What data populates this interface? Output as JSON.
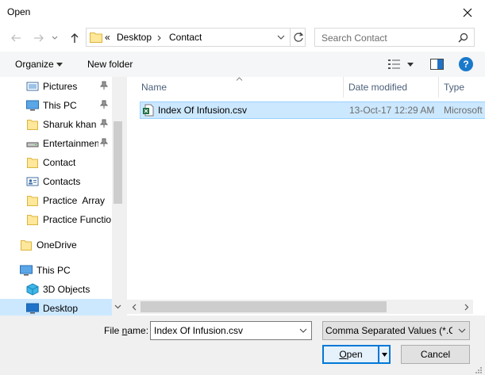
{
  "window": {
    "title": "Open"
  },
  "address": {
    "overflow": "«",
    "crumbs": [
      "Desktop",
      "Contact"
    ]
  },
  "search": {
    "placeholder": "Search Contact"
  },
  "toolbar": {
    "organize_label": "Organize",
    "new_folder_label": "New folder"
  },
  "sidebar": {
    "items": [
      {
        "label": "Pictures",
        "icon": "pictures-icon",
        "pinned": true
      },
      {
        "label": "This PC",
        "icon": "computer-icon",
        "pinned": true
      },
      {
        "label": "Sharuk khan",
        "icon": "folder-icon",
        "pinned": true
      },
      {
        "label": "Entertainmen",
        "icon": "drive-icon",
        "pinned": true
      },
      {
        "label": "Contact",
        "icon": "folder-icon",
        "pinned": false
      },
      {
        "label": "Contacts",
        "icon": "contacts-icon",
        "pinned": false
      },
      {
        "label": "Practice  Array",
        "icon": "folder-icon",
        "pinned": false
      },
      {
        "label": "Practice Functio",
        "icon": "folder-icon",
        "pinned": false
      },
      {
        "label": "OneDrive",
        "icon": "folder-icon",
        "pinned": false
      },
      {
        "label": "This PC",
        "icon": "computer-icon",
        "pinned": false
      },
      {
        "label": "3D Objects",
        "icon": "cube-icon",
        "pinned": false
      },
      {
        "label": "Desktop",
        "icon": "desktop-icon",
        "pinned": false,
        "selected": true
      }
    ]
  },
  "filelist": {
    "columns": [
      "Name",
      "Date modified",
      "Type"
    ],
    "rows": [
      {
        "name": "Index Of Infusion.csv",
        "date": "13-Oct-17 12:29 AM",
        "type": "Microsoft"
      }
    ]
  },
  "footer": {
    "filename_label_pre": "File ",
    "filename_label_u": "n",
    "filename_label_post": "ame:",
    "filename_value": "Index Of Infusion.csv",
    "filetype_value": "Comma Separated Values (*.CS",
    "open_label_u": "O",
    "open_label_rest": "pen",
    "cancel_label": "Cancel"
  },
  "colors": {
    "accent": "#0078d7",
    "selection": "#cce8ff",
    "selection_border": "#99d1ff",
    "help": "#1979ca"
  }
}
